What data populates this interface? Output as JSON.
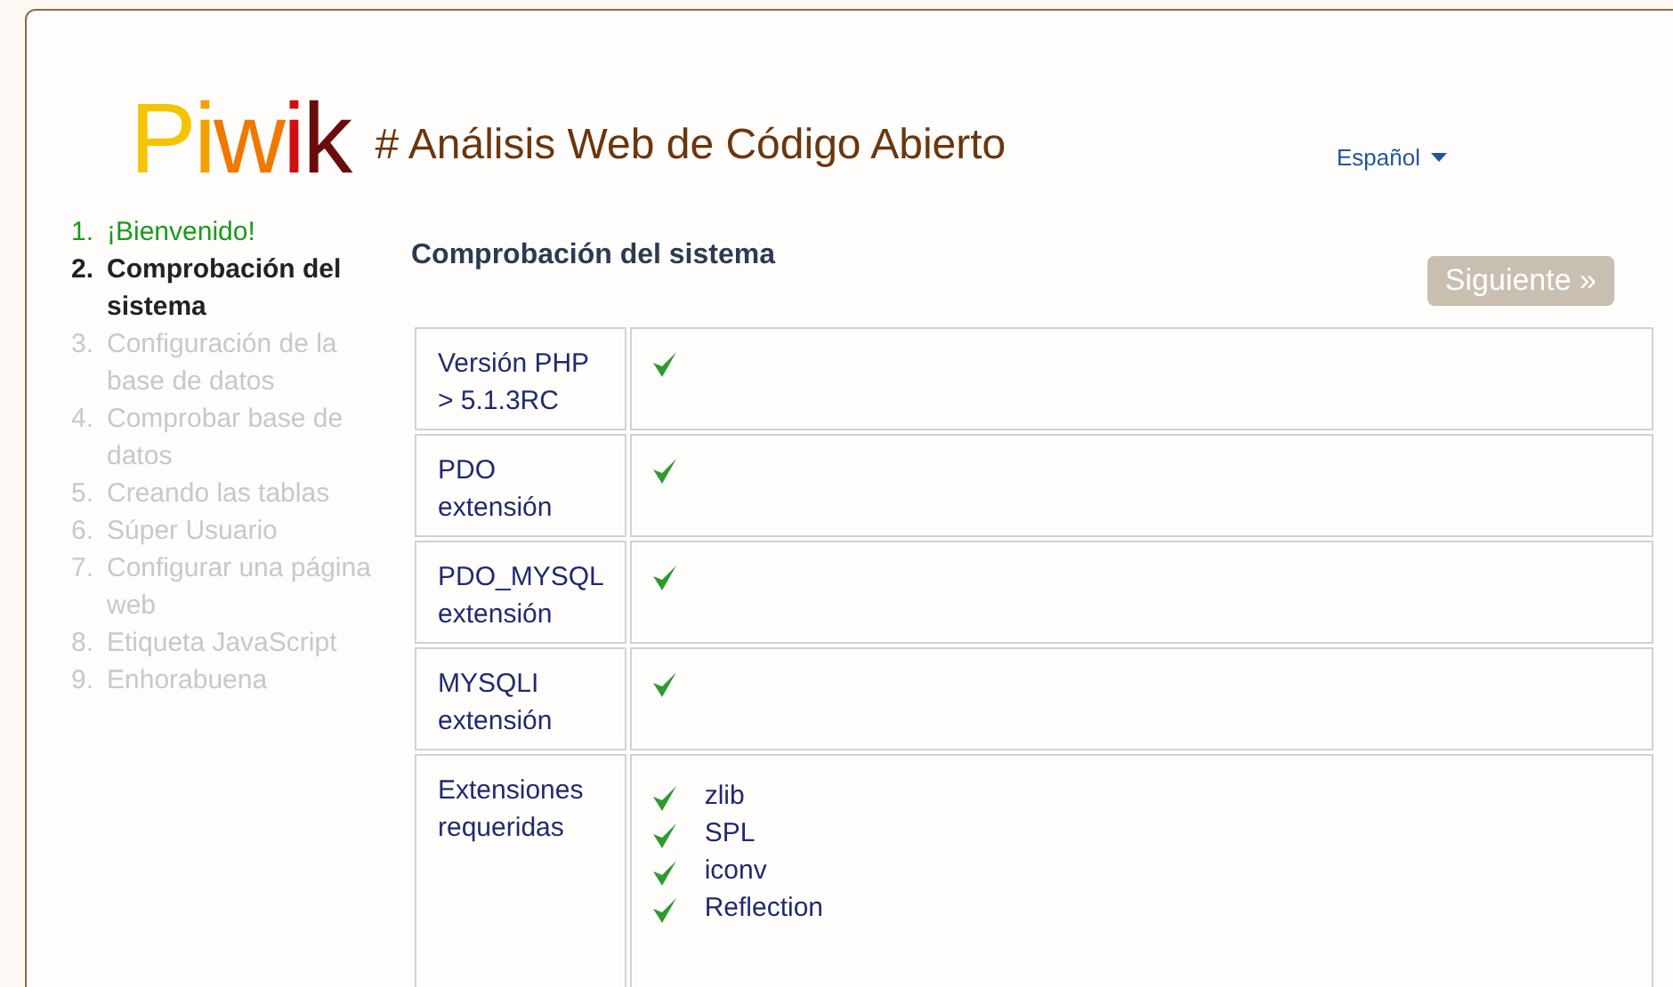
{
  "logo": {
    "text": "Piwik"
  },
  "header": {
    "title": "# Análisis Web de Código Abierto",
    "language": "Español"
  },
  "steps": [
    {
      "number": "1.",
      "label": "¡Bienvenido!",
      "completed": true,
      "selected": false
    },
    {
      "number": "2.",
      "label": "Comprobación del sistema",
      "completed": false,
      "selected": true
    },
    {
      "number": "3.",
      "label": "Configuración de la base de datos",
      "completed": false,
      "selected": false
    },
    {
      "number": "4.",
      "label": "Comprobar base de datos",
      "completed": false,
      "selected": false
    },
    {
      "number": "5.",
      "label": "Creando las tablas",
      "completed": false,
      "selected": false
    },
    {
      "number": "6.",
      "label": "Súper Usuario",
      "completed": false,
      "selected": false
    },
    {
      "number": "7.",
      "label": "Configurar una página web",
      "completed": false,
      "selected": false
    },
    {
      "number": "8.",
      "label": "Etiqueta JavaScript",
      "completed": false,
      "selected": false
    },
    {
      "number": "9.",
      "label": "Enhorabuena",
      "completed": false,
      "selected": false
    }
  ],
  "section_title": "Comprobación del sistema",
  "next_button": "Siguiente »",
  "checks": [
    {
      "label": "Versión PHP > 5.1.3RC",
      "ok": true
    },
    {
      "label": "PDO extensión",
      "ok": true
    },
    {
      "label": "PDO_MYSQL extensión",
      "ok": true
    },
    {
      "label": "MYSQLI extensión",
      "ok": true
    },
    {
      "label": "Extensiones requeridas",
      "items": [
        {
          "name": "zlib",
          "ok": true
        },
        {
          "name": "SPL",
          "ok": true
        },
        {
          "name": "iconv",
          "ok": true
        },
        {
          "name": "Reflection",
          "ok": true
        }
      ]
    }
  ]
}
